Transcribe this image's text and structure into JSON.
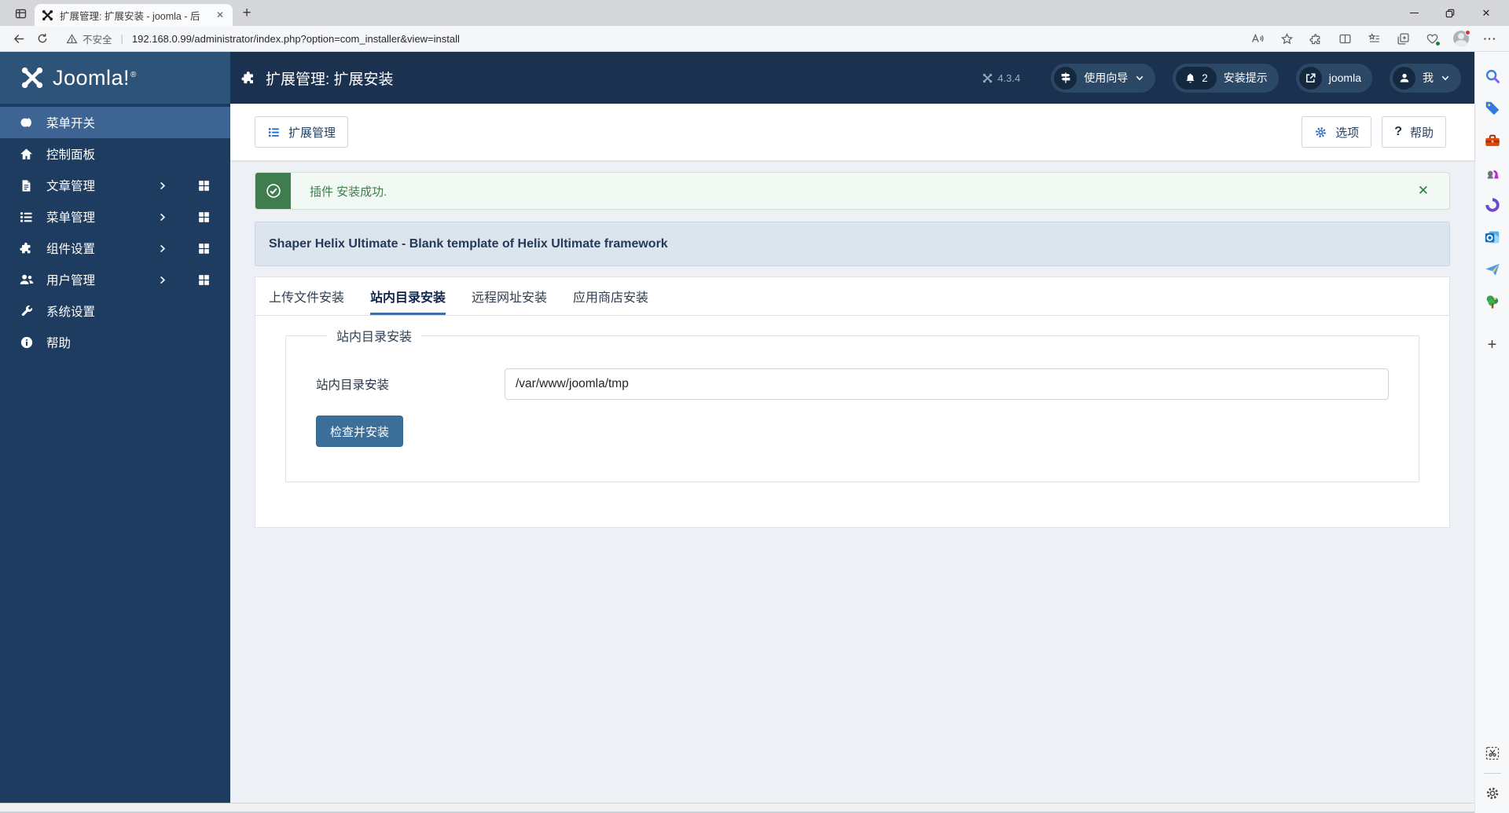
{
  "browser": {
    "tab_bar": {
      "tab_title": "扩展管理: 扩展安装 - joomla - 后",
      "tab_close_glyph": "✕",
      "new_tab_glyph": "+",
      "window_close_glyph": "✕"
    },
    "toolbar": {
      "security_warning": "不安全",
      "divider": "|",
      "url": "192.168.0.99/administrator/index.php?option=com_installer&view=install",
      "more_glyph": "···"
    }
  },
  "joomla": {
    "sidebar": {
      "logo_text": "Joomla!",
      "logo_trademark": "®",
      "items": [
        {
          "label": "菜单开关",
          "icon": "menu-toggle-icon",
          "active": true
        },
        {
          "label": "控制面板",
          "icon": "home-icon"
        },
        {
          "label": "文章管理",
          "icon": "article-icon",
          "has_children": true
        },
        {
          "label": "菜单管理",
          "icon": "menus-icon",
          "has_children": true
        },
        {
          "label": "组件设置",
          "icon": "components-icon",
          "has_children": true
        },
        {
          "label": "用户管理",
          "icon": "users-icon",
          "has_children": true
        },
        {
          "label": "系统设置",
          "icon": "system-icon"
        },
        {
          "label": "帮助",
          "icon": "help-icon"
        }
      ]
    },
    "header": {
      "page_title": "扩展管理: 扩展安装",
      "version": "4.3.4",
      "guide_button": "使用向导",
      "notification_count": "2",
      "notification_button": "安装提示",
      "site_button": "joomla",
      "user_button": "我"
    },
    "toolbar": {
      "manage_button": "扩展管理",
      "options_button": "选项",
      "help_button": "帮助",
      "help_glyph": "?"
    },
    "alert": {
      "message": "插件 安装成功.",
      "close_glyph": "✕"
    },
    "template_notice": "Shaper Helix Ultimate - Blank template of Helix Ultimate framework",
    "tabs": [
      {
        "label": "上传文件安装"
      },
      {
        "label": "站内目录安装",
        "active": true
      },
      {
        "label": "远程网址安装"
      },
      {
        "label": "应用商店安装"
      }
    ],
    "form": {
      "legend": "站内目录安装",
      "field_label": "站内目录安装",
      "field_value": "/var/www/joomla/tmp",
      "submit_button": "检查并安装"
    }
  },
  "edge_sidebar": {
    "items": [
      "search-icon",
      "shopping-icon",
      "tools-icon",
      "games-icon",
      "microsoft-365-icon",
      "outlook-icon",
      "drop-icon",
      "tree-icon",
      "add-icon"
    ],
    "footer": [
      "web-capture-icon",
      "settings-icon"
    ],
    "add_glyph": "+"
  },
  "colors": {
    "header_bg": "#1b3150",
    "sidebar_bg": "#1e3c5f",
    "sidebar_active_bg": "#3d6493",
    "logo_bar_bg": "#2e5379",
    "pill_bg": "#2b4867",
    "pill_icon_bg": "#14293f",
    "accent_blue": "#2a69b8",
    "success_green": "#3f7d4f",
    "alert_bg": "#f2f8f3",
    "template_bar_bg": "#dce4ee",
    "tab_underline": "#3f6ea8",
    "button_bg": "#3b6e98",
    "content_bg": "#edf0f4"
  }
}
